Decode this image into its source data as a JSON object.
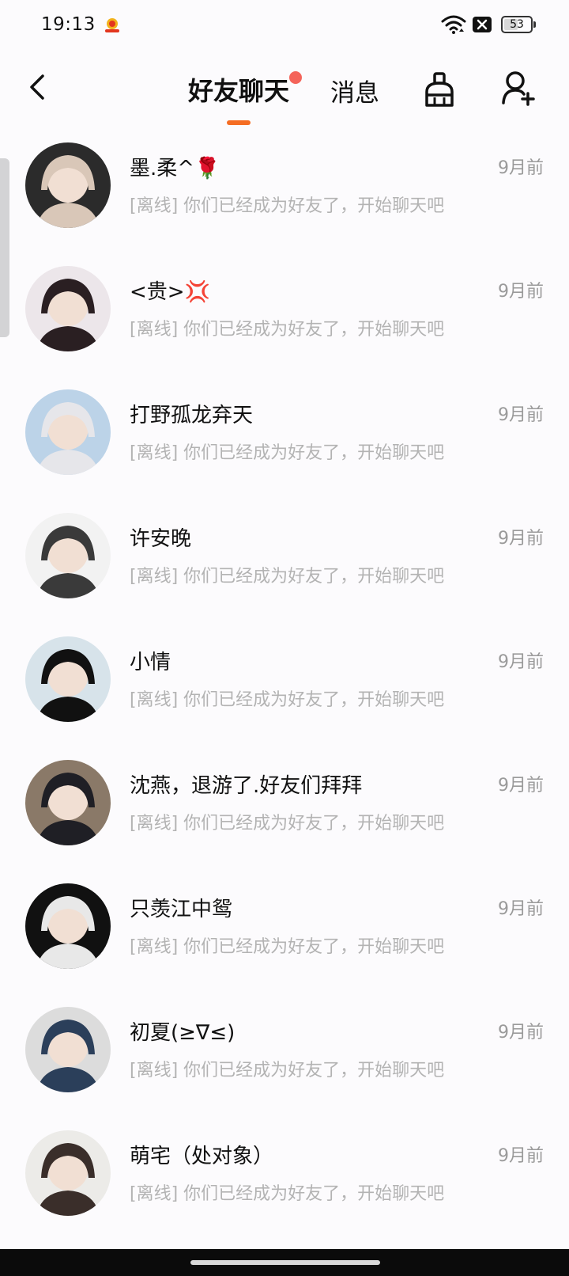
{
  "status_bar": {
    "time": "19:13",
    "app_icon": "app-notification-icon",
    "wifi_icon": "wifi-icon",
    "x_icon": "close-box-icon",
    "battery": "53",
    "battery_level_percent": 53
  },
  "nav": {
    "back_icon": "chevron-left-icon",
    "tabs": [
      {
        "label": "好友聊天",
        "active": true,
        "has_dot": true
      },
      {
        "label": "消息",
        "active": false
      }
    ],
    "clean_icon": "broom-icon",
    "add_friend_icon": "add-user-icon",
    "accent_color": "#f56d23",
    "dot_color": "#f4645a"
  },
  "chats": [
    {
      "name": "墨.柔^🌹",
      "time": "9月前",
      "preview": "[离线] 你们已经成为好友了，开始聊天吧",
      "avatar_colors": [
        "#2b2b2b",
        "#d9c7b8"
      ]
    },
    {
      "name": "<贵>💢",
      "time": "9月前",
      "preview": "[离线] 你们已经成为好友了，开始聊天吧",
      "avatar_colors": [
        "#ece6ea",
        "#2a1f22"
      ]
    },
    {
      "name": "打野孤龙弃天",
      "time": "9月前",
      "preview": "[离线] 你们已经成为好友了，开始聊天吧",
      "avatar_colors": [
        "#bcd3e8",
        "#e6e6ea"
      ]
    },
    {
      "name": "许安晚",
      "time": "9月前",
      "preview": "[离线] 你们已经成为好友了，开始聊天吧",
      "avatar_colors": [
        "#f2f2f2",
        "#3a3a3a"
      ]
    },
    {
      "name": "小情",
      "time": "9月前",
      "preview": "[离线] 你们已经成为好友了，开始聊天吧",
      "avatar_colors": [
        "#d7e3ea",
        "#111111"
      ]
    },
    {
      "name": "沈燕，退游了.好友们拜拜",
      "time": "9月前",
      "preview": "[离线] 你们已经成为好友了，开始聊天吧",
      "avatar_colors": [
        "#8a7968",
        "#1f1f25"
      ]
    },
    {
      "name": "只羡江中鸳",
      "time": "9月前",
      "preview": "[离线] 你们已经成为好友了，开始聊天吧",
      "avatar_colors": [
        "#111111",
        "#e8e8e8"
      ]
    },
    {
      "name": "初夏(≥∇≤)",
      "time": "9月前",
      "preview": "[离线] 你们已经成为好友了，开始聊天吧",
      "avatar_colors": [
        "#dcdcdc",
        "#2b3f5a"
      ]
    },
    {
      "name": "萌宅（处对象）",
      "time": "9月前",
      "preview": "[离线] 你们已经成为好友了，开始聊天吧",
      "avatar_colors": [
        "#ecebe8",
        "#3a2e2a"
      ]
    }
  ]
}
